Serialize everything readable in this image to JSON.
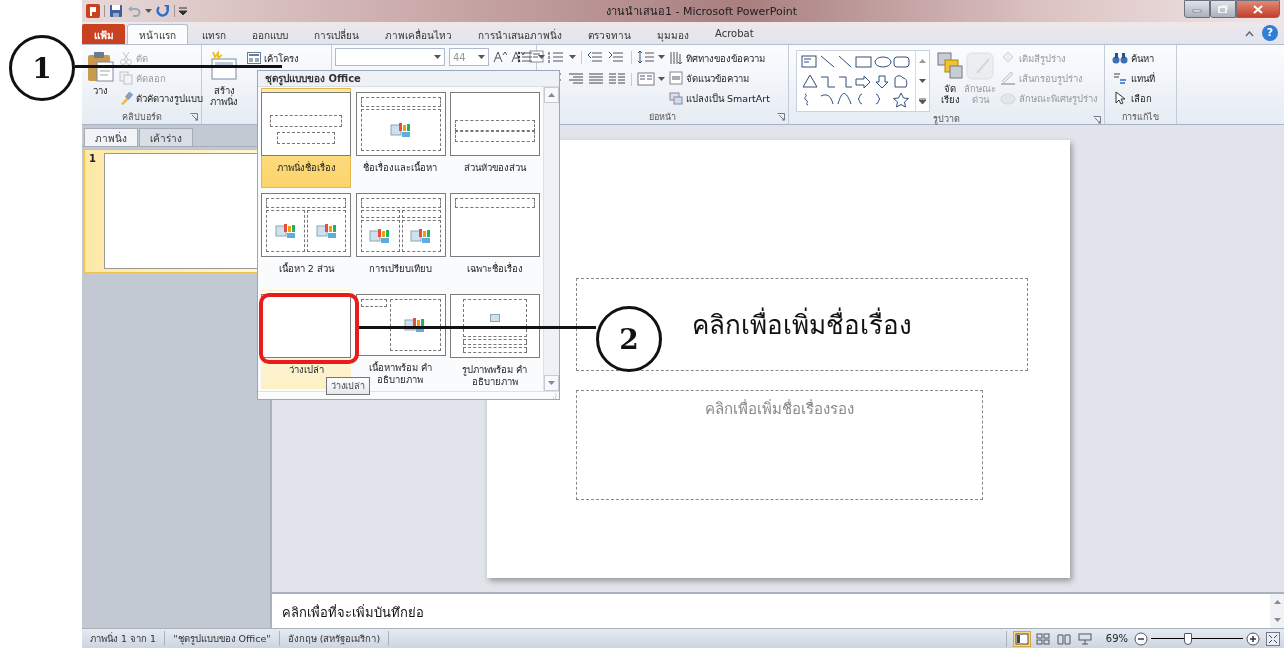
{
  "window": {
    "title": "งานนำเสนอ1 - Microsoft PowerPoint",
    "help_button": "?"
  },
  "ribbon_tabs": [
    {
      "label": "แฟ้ม",
      "kind": "file",
      "selected": false
    },
    {
      "label": "หน้าแรก",
      "kind": "tab",
      "selected": true
    },
    {
      "label": "แทรก",
      "kind": "tab",
      "selected": false
    },
    {
      "label": "ออกแบบ",
      "kind": "tab",
      "selected": false
    },
    {
      "label": "การเปลี่ยน",
      "kind": "tab",
      "selected": false
    },
    {
      "label": "ภาพเคลื่อนไหว",
      "kind": "tab",
      "selected": false
    },
    {
      "label": "การนำเสนอภาพนิ่ง",
      "kind": "tab",
      "selected": false
    },
    {
      "label": "ตรวจทาน",
      "kind": "tab",
      "selected": false
    },
    {
      "label": "มุมมอง",
      "kind": "tab",
      "selected": false
    },
    {
      "label": "Acrobat",
      "kind": "tab",
      "selected": false
    }
  ],
  "ribbon_groups": [
    {
      "kind": "standard",
      "label": "คลิปบอร์ด",
      "commands": [
        {
          "label": "วาง",
          "kind": "large",
          "disabled": false
        },
        {
          "label": "ตัด",
          "kind": "small",
          "disabled": true
        },
        {
          "label": "คัดลอก",
          "kind": "small",
          "disabled": true
        },
        {
          "label": "ตัวคัดวางรูปแบบ",
          "kind": "small",
          "disabled": false
        }
      ]
    },
    {
      "kind": "standard",
      "commands": [
        {
          "label": "สร้าง ภาพนิ่ง",
          "kind": "large",
          "disabled": false
        },
        {
          "label": "เค้าโครง",
          "kind": "small",
          "disabled": false
        }
      ]
    },
    {
      "kind": "font",
      "font_size": "44"
    },
    {
      "kind": "paragraph",
      "label": "ย่อหน้า",
      "commands": [
        {
          "label": "ทิศทางของข้อความ",
          "kind": "small",
          "disabled": false
        },
        {
          "label": "จัดแนวข้อความ",
          "kind": "small",
          "disabled": false
        },
        {
          "label": "แปลงเป็น SmartArt",
          "kind": "small",
          "disabled": false
        }
      ]
    },
    {
      "kind": "drawing",
      "label": "รูปวาด",
      "commands": [
        {
          "label": "จัดเรียง",
          "kind": "large",
          "disabled": false
        },
        {
          "label": "ลักษณะ ด่วน",
          "kind": "large",
          "disabled": true
        },
        {
          "label": "เติมสีรูปร่าง",
          "kind": "small",
          "disabled": true
        },
        {
          "label": "เส้นกรอบรูปร่าง",
          "kind": "small",
          "disabled": true
        },
        {
          "label": "ลักษณะพิเศษรูปร่าง",
          "kind": "small",
          "disabled": true
        }
      ]
    },
    {
      "kind": "standard",
      "label": "การแก้ไข",
      "commands": [
        {
          "label": "ค้นหา",
          "kind": "small",
          "disabled": false
        },
        {
          "label": "แทนที่",
          "kind": "small",
          "disabled": false
        },
        {
          "label": "เลือก",
          "kind": "small",
          "disabled": false
        }
      ]
    }
  ],
  "panel_tabs": [
    {
      "label": "ภาพนิ่ง",
      "selected": true
    },
    {
      "label": "เค้าร่าง",
      "selected": false
    }
  ],
  "thumbnails": [
    {
      "number": "1",
      "selected": true
    }
  ],
  "slide": {
    "title_placeholder": "คลิกเพื่อเพิ่มชื่อเรื่อง",
    "subtitle_placeholder": "คลิกเพื่อเพิ่มชื่อเรื่องรอง"
  },
  "notes": {
    "placeholder": "คลิกเพื่อที่จะเพิ่มบันทึกย่อ"
  },
  "layout_gallery": {
    "title": "ชุดรูปแบบของ Office",
    "tooltip": "ว่างเปล่า",
    "layouts": [
      {
        "label": "ภาพนิ่งชื่อเรื่อง",
        "kind": "title",
        "selected": true,
        "hovered": false
      },
      {
        "label": "ชื่อเรื่องและเนื้อหา",
        "kind": "title_content",
        "selected": false,
        "hovered": false
      },
      {
        "label": "ส่วนหัวของส่วน",
        "kind": "section",
        "selected": false,
        "hovered": false
      },
      {
        "label": "เนื้อหา 2 ส่วน",
        "kind": "two_content",
        "selected": false,
        "hovered": false
      },
      {
        "label": "การเปรียบเทียบ",
        "kind": "comparison",
        "selected": false,
        "hovered": false
      },
      {
        "label": "เฉพาะชื่อเรื่อง",
        "kind": "title_only",
        "selected": false,
        "hovered": false
      },
      {
        "label": "ว่างเปล่า",
        "kind": "blank",
        "selected": false,
        "hovered": true
      },
      {
        "label": "เนื้อหาพร้อม คำอธิบายภาพ",
        "kind": "content_caption",
        "selected": false,
        "hovered": false
      },
      {
        "label": "รูปภาพพร้อม คำอธิบายภาพ",
        "kind": "picture_caption",
        "selected": false,
        "hovered": false
      }
    ]
  },
  "status_bar": {
    "items": [
      "ภาพนิ่ง 1 จาก 1",
      "\"ชุดรูปแบบของ Office\"",
      "อังกฤษ (สหรัฐอเมริกา)"
    ],
    "views": [
      {
        "kind": "normal",
        "selected": true
      },
      {
        "kind": "sorter",
        "selected": false
      },
      {
        "kind": "reading",
        "selected": false
      },
      {
        "kind": "slideshow",
        "selected": false
      }
    ],
    "zoom": "69%",
    "zoom_slider": {
      "level": 0.4
    }
  },
  "callouts": [
    {
      "label": "1",
      "highlight": false
    },
    {
      "label": "2",
      "highlight": true
    }
  ]
}
